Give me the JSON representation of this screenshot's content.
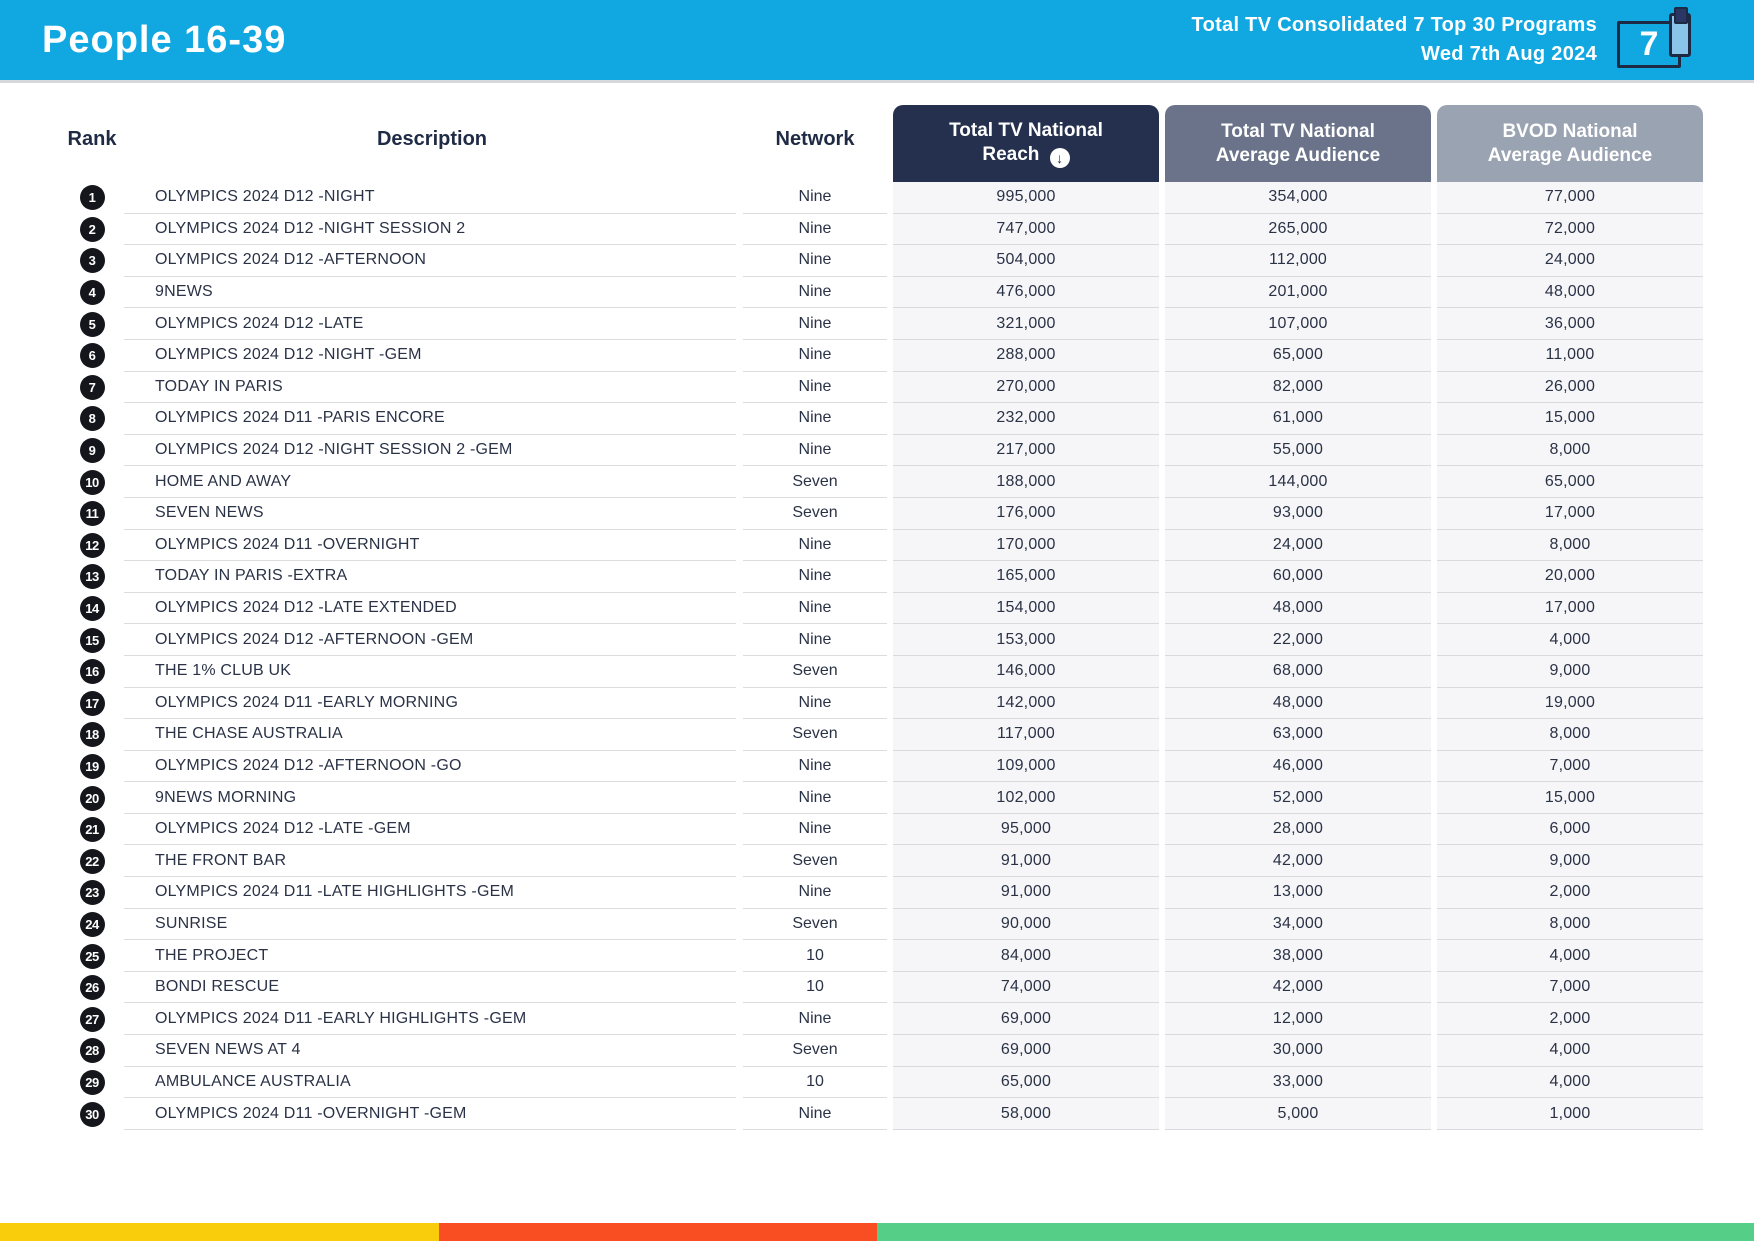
{
  "header": {
    "title": "People 16-39",
    "subtitle_line1": "Total TV Consolidated 7 Top 30 Programs",
    "subtitle_line2": "Wed 7th Aug 2024",
    "logo_number": "7",
    "background_color": "#11A8E1"
  },
  "table": {
    "columns": {
      "rank": "Rank",
      "description": "Description",
      "network": "Network",
      "reach": "Total TV National Reach",
      "avg": "Total TV National Average Audience",
      "bvod": "BVOD National Average Audience"
    },
    "sort_icon_glyph": "↓",
    "header_colors": {
      "reach": "#25304E",
      "avg": "#6A7389",
      "bvod": "#9AA3B1"
    },
    "rows": [
      {
        "rank": "1",
        "description": "OLYMPICS 2024 D12 -NIGHT",
        "network": "Nine",
        "reach": "995,000",
        "avg": "354,000",
        "bvod": "77,000"
      },
      {
        "rank": "2",
        "description": "OLYMPICS 2024 D12 -NIGHT SESSION 2",
        "network": "Nine",
        "reach": "747,000",
        "avg": "265,000",
        "bvod": "72,000"
      },
      {
        "rank": "3",
        "description": "OLYMPICS 2024 D12 -AFTERNOON",
        "network": "Nine",
        "reach": "504,000",
        "avg": "112,000",
        "bvod": "24,000"
      },
      {
        "rank": "4",
        "description": "9NEWS",
        "network": "Nine",
        "reach": "476,000",
        "avg": "201,000",
        "bvod": "48,000"
      },
      {
        "rank": "5",
        "description": "OLYMPICS 2024 D12 -LATE",
        "network": "Nine",
        "reach": "321,000",
        "avg": "107,000",
        "bvod": "36,000"
      },
      {
        "rank": "6",
        "description": "OLYMPICS 2024 D12 -NIGHT -GEM",
        "network": "Nine",
        "reach": "288,000",
        "avg": "65,000",
        "bvod": "11,000"
      },
      {
        "rank": "7",
        "description": "TODAY IN PARIS",
        "network": "Nine",
        "reach": "270,000",
        "avg": "82,000",
        "bvod": "26,000"
      },
      {
        "rank": "8",
        "description": "OLYMPICS 2024 D11 -PARIS ENCORE",
        "network": "Nine",
        "reach": "232,000",
        "avg": "61,000",
        "bvod": "15,000"
      },
      {
        "rank": "9",
        "description": "OLYMPICS 2024 D12 -NIGHT SESSION 2 -GEM",
        "network": "Nine",
        "reach": "217,000",
        "avg": "55,000",
        "bvod": "8,000"
      },
      {
        "rank": "10",
        "description": "HOME AND AWAY",
        "network": "Seven",
        "reach": "188,000",
        "avg": "144,000",
        "bvod": "65,000"
      },
      {
        "rank": "11",
        "description": "SEVEN NEWS",
        "network": "Seven",
        "reach": "176,000",
        "avg": "93,000",
        "bvod": "17,000"
      },
      {
        "rank": "12",
        "description": "OLYMPICS 2024 D11 -OVERNIGHT",
        "network": "Nine",
        "reach": "170,000",
        "avg": "24,000",
        "bvod": "8,000"
      },
      {
        "rank": "13",
        "description": "TODAY IN PARIS -EXTRA",
        "network": "Nine",
        "reach": "165,000",
        "avg": "60,000",
        "bvod": "20,000"
      },
      {
        "rank": "14",
        "description": "OLYMPICS 2024 D12 -LATE EXTENDED",
        "network": "Nine",
        "reach": "154,000",
        "avg": "48,000",
        "bvod": "17,000"
      },
      {
        "rank": "15",
        "description": "OLYMPICS 2024 D12 -AFTERNOON -GEM",
        "network": "Nine",
        "reach": "153,000",
        "avg": "22,000",
        "bvod": "4,000"
      },
      {
        "rank": "16",
        "description": "THE 1% CLUB UK",
        "network": "Seven",
        "reach": "146,000",
        "avg": "68,000",
        "bvod": "9,000"
      },
      {
        "rank": "17",
        "description": "OLYMPICS 2024 D11 -EARLY MORNING",
        "network": "Nine",
        "reach": "142,000",
        "avg": "48,000",
        "bvod": "19,000"
      },
      {
        "rank": "18",
        "description": "THE CHASE AUSTRALIA",
        "network": "Seven",
        "reach": "117,000",
        "avg": "63,000",
        "bvod": "8,000"
      },
      {
        "rank": "19",
        "description": "OLYMPICS 2024 D12 -AFTERNOON -GO",
        "network": "Nine",
        "reach": "109,000",
        "avg": "46,000",
        "bvod": "7,000"
      },
      {
        "rank": "20",
        "description": "9NEWS MORNING",
        "network": "Nine",
        "reach": "102,000",
        "avg": "52,000",
        "bvod": "15,000"
      },
      {
        "rank": "21",
        "description": "OLYMPICS 2024 D12 -LATE -GEM",
        "network": "Nine",
        "reach": "95,000",
        "avg": "28,000",
        "bvod": "6,000"
      },
      {
        "rank": "22",
        "description": "THE FRONT BAR",
        "network": "Seven",
        "reach": "91,000",
        "avg": "42,000",
        "bvod": "9,000"
      },
      {
        "rank": "23",
        "description": "OLYMPICS 2024 D11 -LATE HIGHLIGHTS -GEM",
        "network": "Nine",
        "reach": "91,000",
        "avg": "13,000",
        "bvod": "2,000"
      },
      {
        "rank": "24",
        "description": "SUNRISE",
        "network": "Seven",
        "reach": "90,000",
        "avg": "34,000",
        "bvod": "8,000"
      },
      {
        "rank": "25",
        "description": "THE PROJECT",
        "network": "10",
        "reach": "84,000",
        "avg": "38,000",
        "bvod": "4,000"
      },
      {
        "rank": "26",
        "description": "BONDI RESCUE",
        "network": "10",
        "reach": "74,000",
        "avg": "42,000",
        "bvod": "7,000"
      },
      {
        "rank": "27",
        "description": "OLYMPICS 2024 D11 -EARLY HIGHLIGHTS -GEM",
        "network": "Nine",
        "reach": "69,000",
        "avg": "12,000",
        "bvod": "2,000"
      },
      {
        "rank": "28",
        "description": "SEVEN NEWS AT 4",
        "network": "Seven",
        "reach": "69,000",
        "avg": "30,000",
        "bvod": "4,000"
      },
      {
        "rank": "29",
        "description": "AMBULANCE AUSTRALIA",
        "network": "10",
        "reach": "65,000",
        "avg": "33,000",
        "bvod": "4,000"
      },
      {
        "rank": "30",
        "description": "OLYMPICS 2024 D11 -OVERNIGHT -GEM",
        "network": "Nine",
        "reach": "58,000",
        "avg": "5,000",
        "bvod": "1,000"
      }
    ]
  },
  "footer": {
    "stripe": [
      {
        "color": "#F9CD0C",
        "width_pct": 25
      },
      {
        "color": "#F94E22",
        "width_pct": 25
      },
      {
        "color": "#55CF88",
        "width_pct": 50
      }
    ]
  }
}
